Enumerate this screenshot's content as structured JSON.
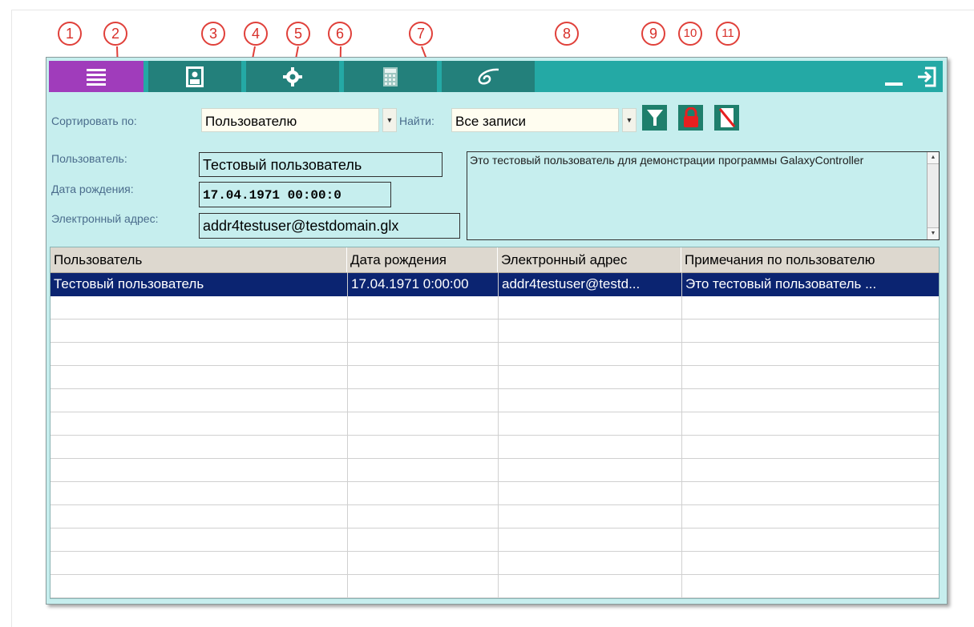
{
  "callouts": [
    "1",
    "2",
    "3",
    "4",
    "5",
    "6",
    "7",
    "8",
    "9",
    "10",
    "11"
  ],
  "toolbar": {
    "tabs": [
      {
        "icon": "list-icon",
        "active": true
      },
      {
        "icon": "user-card-icon",
        "active": false
      },
      {
        "icon": "gear-icon",
        "active": false
      },
      {
        "icon": "calculator-icon",
        "active": false
      },
      {
        "icon": "galaxy-logo-icon",
        "active": false
      }
    ],
    "minimize_icon": "minimize-icon",
    "exit_icon": "exit-icon"
  },
  "filter_bar": {
    "sort_label": "Сортировать по:",
    "sort_value": "Пользователю",
    "find_label": "Найти:",
    "find_value": "Все записи",
    "filter_icon": "filter-icon",
    "lock_icon": "lock-icon",
    "clear_filter_icon": "clear-filter-icon"
  },
  "details": {
    "user_label": "Пользователь:",
    "user_value": "Тестовый пользователь",
    "birth_label": "Дата рождения:",
    "birth_value": "17.04.1971 00:00:0",
    "email_label": "Электронный адрес:",
    "email_value": "addr4testuser@testdomain.glx",
    "notes": "Это тестовый пользователь для демонстрации программы GalaxyController"
  },
  "grid": {
    "columns": [
      "Пользователь",
      "Дата рождения",
      "Электронный адрес",
      "Примечания по пользователю"
    ],
    "rows": [
      [
        "Тестовый пользователь",
        "17.04.1971 0:00:00",
        "addr4testuser@testd...",
        "Это тестовый пользователь ..."
      ]
    ]
  },
  "colors": {
    "toolbar_bg": "#24a9a5",
    "tab_bg": "#23807b",
    "tab_active": "#a03cbb",
    "panel_bg": "#c6eeee",
    "selected_row": "#0b2471",
    "callout": "#e0403a"
  }
}
